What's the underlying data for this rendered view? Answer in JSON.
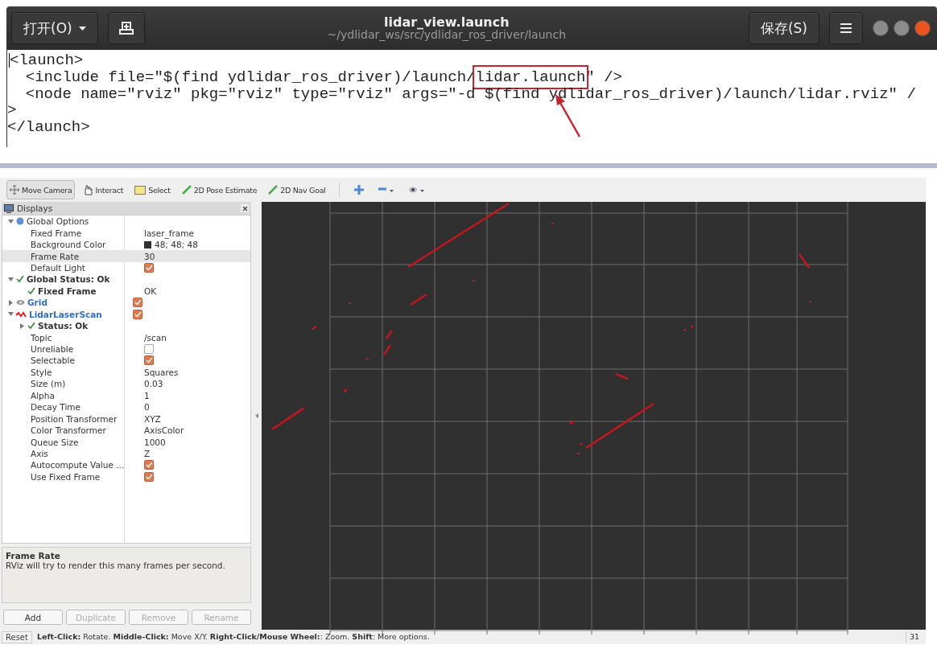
{
  "editor": {
    "open_button": "打开(O)",
    "title": "lidar_view.launch",
    "path": "~/ydlidar_ws/src/ydlidar_ros_driver/launch",
    "save_button": "保存(S)",
    "lines": [
      [
        {
          "text": "<launch>"
        }
      ],
      [
        {
          "text": "  <include file=\"$(find ydlidar_ros_driver)/launch/"
        },
        {
          "text": "lidar.launch",
          "boxed": true
        },
        {
          "text": "\" />"
        }
      ],
      [
        {
          "text": "  <node name=\"rviz\" pkg=\"rviz\" type=\"rviz\" args=\"-d $(find ydlidar_ros_driver)/launch/lidar.rviz\" /"
        }
      ],
      [
        {
          "text": ">"
        }
      ],
      [
        {
          "text": "</launch>"
        }
      ]
    ]
  },
  "rviz": {
    "tools": [
      {
        "label": "Move Camera",
        "selected": true
      },
      {
        "label": "Interact",
        "selected": false
      },
      {
        "label": "Select",
        "selected": false
      },
      {
        "label": "2D Pose Estimate",
        "selected": false
      },
      {
        "label": "2D Nav Goal",
        "selected": false
      }
    ],
    "displays": {
      "title": "Displays",
      "tree": [
        {
          "label": "Global Options",
          "kind": "options",
          "expanded": true,
          "selected": false,
          "children": [
            {
              "label": "Fixed Frame",
              "kind": "property",
              "value": "laser_frame",
              "selected": false
            },
            {
              "label": "Background Color",
              "kind": "property",
              "value": "48; 48; 48",
              "color": "#303030",
              "selected": false
            },
            {
              "label": "Frame Rate",
              "kind": "property",
              "value": "30",
              "selected": true
            },
            {
              "label": "Default Light",
              "kind": "property",
              "checked": true,
              "selected": false
            }
          ]
        },
        {
          "label": "Global Status: Ok",
          "kind": "status",
          "expanded": true,
          "selected": false,
          "children": [
            {
              "label": "Fixed Frame",
              "kind": "status",
              "value": "OK",
              "selected": false
            }
          ]
        },
        {
          "label": "Grid",
          "kind": "grid",
          "expanded": false,
          "checked": true,
          "selected": false
        },
        {
          "label": "LidarLaserScan",
          "kind": "scan",
          "expanded": true,
          "checked": true,
          "selected": false,
          "children": [
            {
              "label": "Status: Ok",
              "kind": "status",
              "expanded": false,
              "selected": false
            },
            {
              "label": "Topic",
              "kind": "property",
              "value": "/scan",
              "selected": false
            },
            {
              "label": "Unreliable",
              "kind": "property",
              "checked": false,
              "selected": false
            },
            {
              "label": "Selectable",
              "kind": "property",
              "checked": true,
              "selected": false
            },
            {
              "label": "Style",
              "kind": "property",
              "value": "Squares",
              "selected": false
            },
            {
              "label": "Size (m)",
              "kind": "property",
              "value": "0.03",
              "selected": false
            },
            {
              "label": "Alpha",
              "kind": "property",
              "value": "1",
              "selected": false
            },
            {
              "label": "Decay Time",
              "kind": "property",
              "value": "0",
              "selected": false
            },
            {
              "label": "Position Transformer",
              "kind": "property",
              "value": "XYZ",
              "selected": false
            },
            {
              "label": "Color Transformer",
              "kind": "property",
              "value": "AxisColor",
              "selected": false
            },
            {
              "label": "Queue Size",
              "kind": "property",
              "value": "1000",
              "selected": false
            },
            {
              "label": "Axis",
              "kind": "property",
              "value": "Z",
              "selected": false
            },
            {
              "label": "Autocompute Value ...",
              "kind": "property",
              "checked": true,
              "selected": false
            },
            {
              "label": "Use Fixed Frame",
              "kind": "property",
              "checked": true,
              "selected": false
            }
          ]
        }
      ]
    },
    "description": {
      "title": "Frame Rate",
      "text": "RViz will try to render this many frames per second."
    },
    "buttons": [
      {
        "label": "Add",
        "disabled": false
      },
      {
        "label": "Duplicate",
        "disabled": true
      },
      {
        "label": "Remove",
        "disabled": true
      },
      {
        "label": "Rename",
        "disabled": true
      }
    ],
    "status_bar": {
      "reset": "Reset",
      "hint": "**Left-Click:** Rotate. **Middle-Click:** Move X/Y. **Right-Click/Mouse Wheel:**: Zoom. **Shift**: More options.",
      "fps": "31"
    }
  }
}
